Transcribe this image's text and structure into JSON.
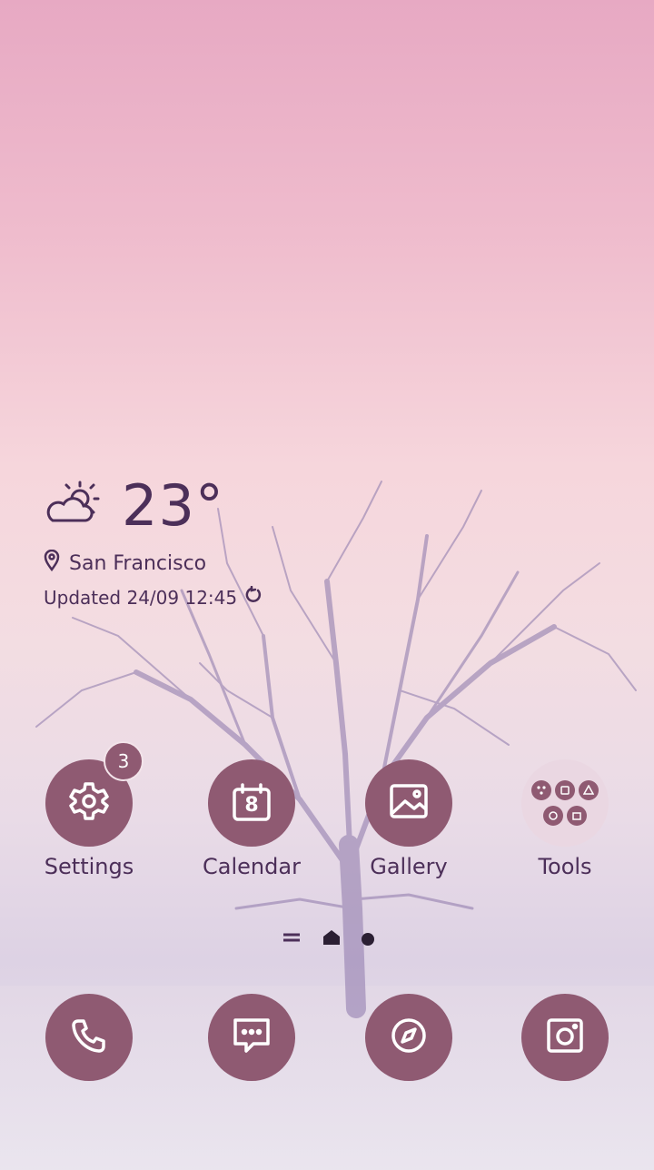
{
  "weather": {
    "temperature": "23°",
    "location": "San Francisco",
    "updated": "Updated 24/09 12:45",
    "icon": "partly-sunny-icon"
  },
  "apps": [
    {
      "label": "Settings",
      "icon": "gear-icon",
      "badge": "3"
    },
    {
      "label": "Calendar",
      "icon": "calendar-icon",
      "date": "8"
    },
    {
      "label": "Gallery",
      "icon": "image-icon"
    },
    {
      "label": "Tools",
      "icon": "folder-icon"
    }
  ],
  "dock": [
    {
      "icon": "phone-icon"
    },
    {
      "icon": "message-icon"
    },
    {
      "icon": "compass-icon"
    },
    {
      "icon": "camera-icon"
    }
  ],
  "colors": {
    "accent": "#8f5a72",
    "text": "#4c2f59"
  }
}
